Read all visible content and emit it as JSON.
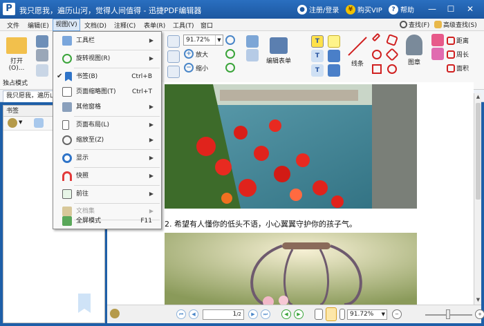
{
  "titlebar": {
    "logo": "P",
    "title": "我只愿我，遍历山河，觉得人间值得  -  迅捷PDF编辑器",
    "login": "注册/登录",
    "vip": "购买VIP",
    "vip_symbol": "¥",
    "help": "帮助",
    "help_symbol": "?",
    "minimize": "—",
    "maximize": "☐",
    "close": "✕"
  },
  "menubar": {
    "items": [
      "文件",
      "编辑(E)",
      "视图(V)",
      "文档(D)",
      "注释(C)",
      "表单(R)",
      "工具(T)",
      "窗口"
    ],
    "find": "查找(F)",
    "advanced_find": "高级查找(S)"
  },
  "ribbon": {
    "open": "打开(O)...",
    "zoom": "91.72%",
    "zoom_in": "放大",
    "zoom_out": "缩小",
    "edit_form": "编辑表单",
    "line": "线条",
    "stamp": "图章",
    "distance": "距离",
    "perimeter": "周长",
    "area": "面积",
    "exclusive_mode": "独占模式"
  },
  "tab": {
    "doc": "我只愿我，遍历山"
  },
  "left_panel": {
    "title": "书签"
  },
  "document": {
    "caption": "2. 希望有人懂你的低头不语，小心翼翼守护你的孩子气。"
  },
  "bottombar": {
    "page": "1",
    "page_total": "/2",
    "zoom": "91.72%"
  },
  "dropdown": {
    "items": [
      {
        "label": "工具栏",
        "shortcut": "",
        "submenu": true,
        "disabled": false,
        "checked": false
      },
      {
        "label": "旋转视图(R)",
        "shortcut": "",
        "submenu": true,
        "disabled": false,
        "checked": false
      },
      {
        "label": "书签(B)",
        "shortcut": "Ctrl+B",
        "submenu": false,
        "disabled": false,
        "checked": true
      },
      {
        "label": "页面缩略图(T)",
        "shortcut": "Ctrl+T",
        "submenu": false,
        "disabled": false,
        "checked": false
      },
      {
        "label": "其他窗格",
        "shortcut": "",
        "submenu": true,
        "disabled": false,
        "checked": false
      },
      {
        "label": "页面布局(L)",
        "shortcut": "",
        "submenu": true,
        "disabled": false,
        "checked": false
      },
      {
        "label": "缩放至(Z)",
        "shortcut": "",
        "submenu": true,
        "disabled": false,
        "checked": false
      },
      {
        "label": "显示",
        "shortcut": "",
        "submenu": true,
        "disabled": false,
        "checked": false
      },
      {
        "label": "快照",
        "shortcut": "",
        "submenu": true,
        "disabled": false,
        "checked": false
      },
      {
        "label": "前往",
        "shortcut": "",
        "submenu": true,
        "disabled": false,
        "checked": false
      },
      {
        "label": "文档集",
        "shortcut": "",
        "submenu": true,
        "disabled": true,
        "checked": false
      },
      {
        "label": "全屏模式",
        "shortcut": "F11",
        "submenu": false,
        "disabled": false,
        "checked": false
      }
    ],
    "check_mark": "✔",
    "arrow": "▶"
  },
  "colors": {
    "titlebar": "#1c57a0",
    "accent": "#4a86c8",
    "menu_highlight": "#dbe8f7"
  }
}
